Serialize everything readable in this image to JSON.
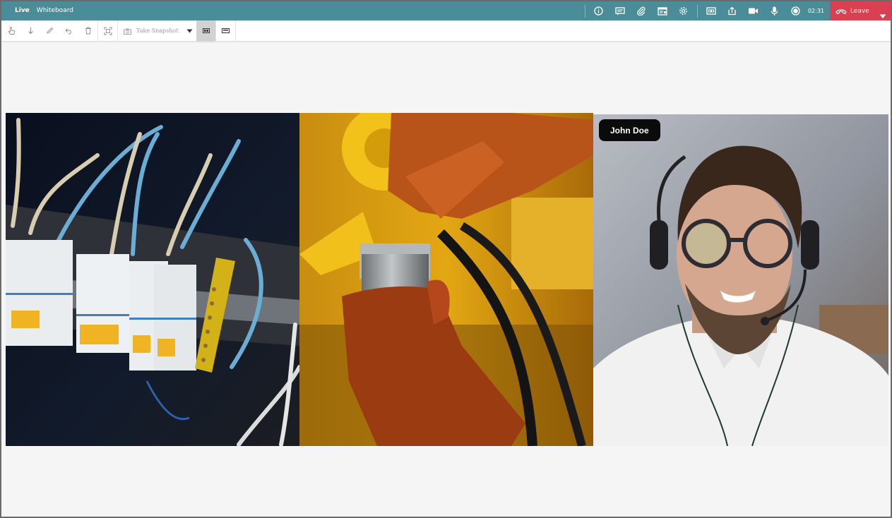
{
  "header": {
    "tabs": [
      {
        "label": "Live"
      },
      {
        "label": "Whiteboard"
      }
    ],
    "icons": [
      "info-icon",
      "chat-icon",
      "attachment-icon",
      "notes-icon",
      "settings-icon",
      "captions-icon",
      "share-screen-icon",
      "camera-icon",
      "microphone-icon",
      "record-icon"
    ],
    "timer": "02:31",
    "leave_label": "Leave",
    "colors": {
      "bar": "#4a8d98",
      "leave": "#d94052"
    }
  },
  "toolbar": {
    "tools": [
      "hand-pointer-icon",
      "arrow-down-icon",
      "pencil-icon",
      "undo-icon",
      "trash-icon",
      "scan-icon"
    ],
    "snapshot_label": "Take Snapshot",
    "layouts": [
      "grid-layout-icon",
      "single-layout-icon"
    ]
  },
  "tiles": [
    {
      "subject": "electrical-panel-breakers"
    },
    {
      "subject": "gloved-hands-machinery"
    },
    {
      "subject": "participant-with-headset",
      "name": "John Doe"
    }
  ]
}
